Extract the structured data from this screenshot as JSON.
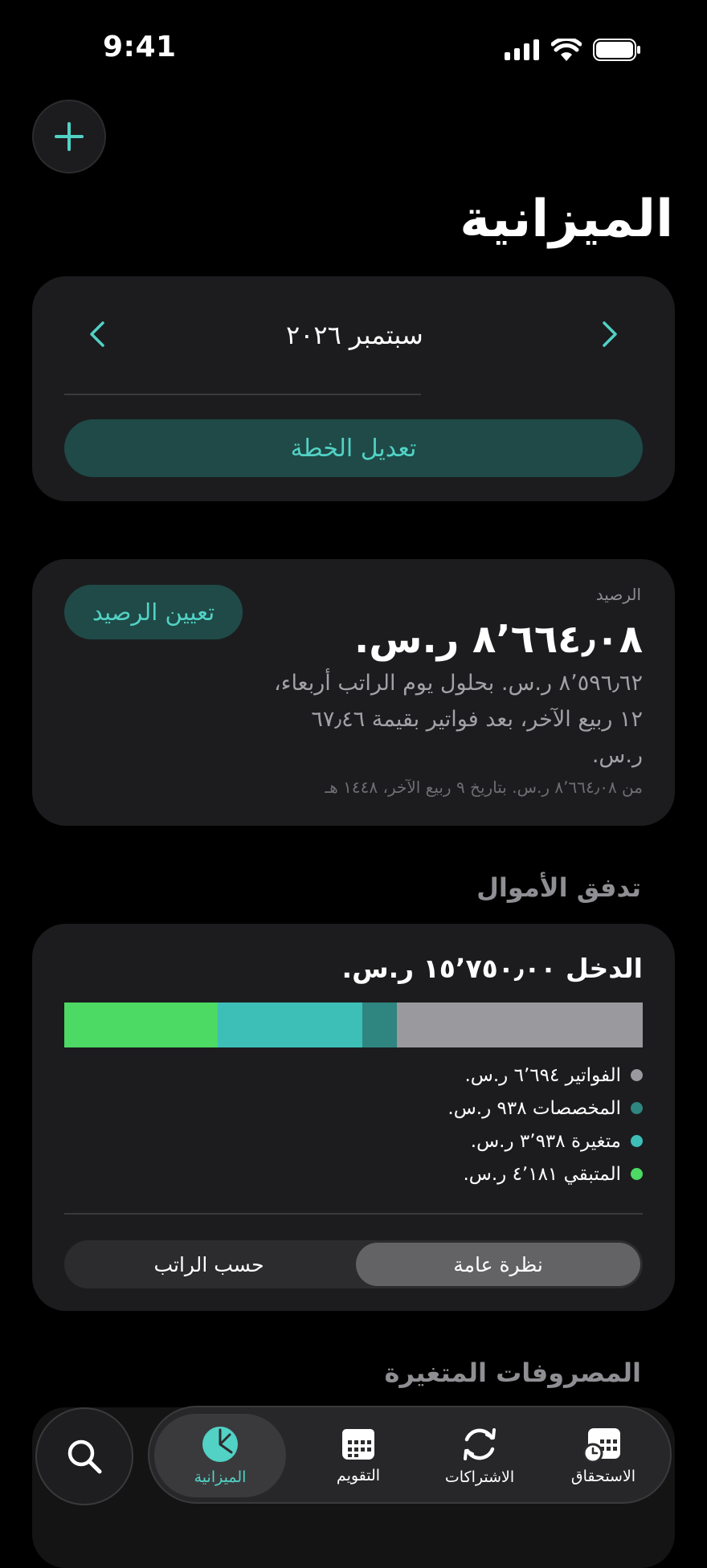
{
  "status_bar": {
    "time": "9:41"
  },
  "header": {
    "title": "الميزانية"
  },
  "month_selector": {
    "label": "سبتمبر ٢٠٢٦",
    "edit_plan_label": "تعديل الخطة"
  },
  "balance": {
    "label": "الرصيد",
    "amount": "٨٬٦٦٤٫٠٨ ر.س.",
    "detail": "٨٬٥٩٦٫٦٢ ر.س. بحلول يوم الراتب أربعاء، ١٢ ربيع الآخر، بعد فواتير بقيمة ٦٧٫٤٦ ر.س.",
    "footnote": "من ٨٬٦٦٤٫٠٨ ر.س. بتاريخ ٩ ربيع الآخر، ١٤٤٨ هـ",
    "set_balance_label": "تعيين الرصيد"
  },
  "cash_flow": {
    "section_title": "تدفق الأموال",
    "income_label": "الدخل ١٥٬٧٥٠٫٠٠ ر.س.",
    "legend": [
      {
        "label": "الفواتير ٦٬٦٩٤ ر.س.",
        "value": 6694,
        "color": "#9a9a9e"
      },
      {
        "label": "المخصصات ٩٣٨ ر.س.",
        "value": 938,
        "color": "#2f8580"
      },
      {
        "label": "متغيرة ٣٬٩٣٨ ر.س.",
        "value": 3938,
        "color": "#3dbeb7"
      },
      {
        "label": "المتبقي ٤٬١٨١ ر.س.",
        "value": 4181,
        "color": "#4cd964"
      }
    ],
    "segments": {
      "overview": "نظرة عامة",
      "by_payday": "حسب الراتب",
      "selected": "overview"
    }
  },
  "variable_expenses": {
    "section_title": "المصروفات المتغيرة"
  },
  "tab_bar": {
    "tabs": [
      {
        "label": "الميزانية",
        "icon": "pie-chart-icon",
        "active": true
      },
      {
        "label": "التقويم",
        "icon": "calendar-icon",
        "active": false
      },
      {
        "label": "الاشتراكات",
        "icon": "refresh-icon",
        "active": false
      },
      {
        "label": "الاستحقاق",
        "icon": "calendar-clock-icon",
        "active": false
      }
    ]
  },
  "colors": {
    "accent": "#52d1c5",
    "accent_bg": "#1f4a47",
    "card": "#1c1c1e",
    "background": "#000000"
  }
}
